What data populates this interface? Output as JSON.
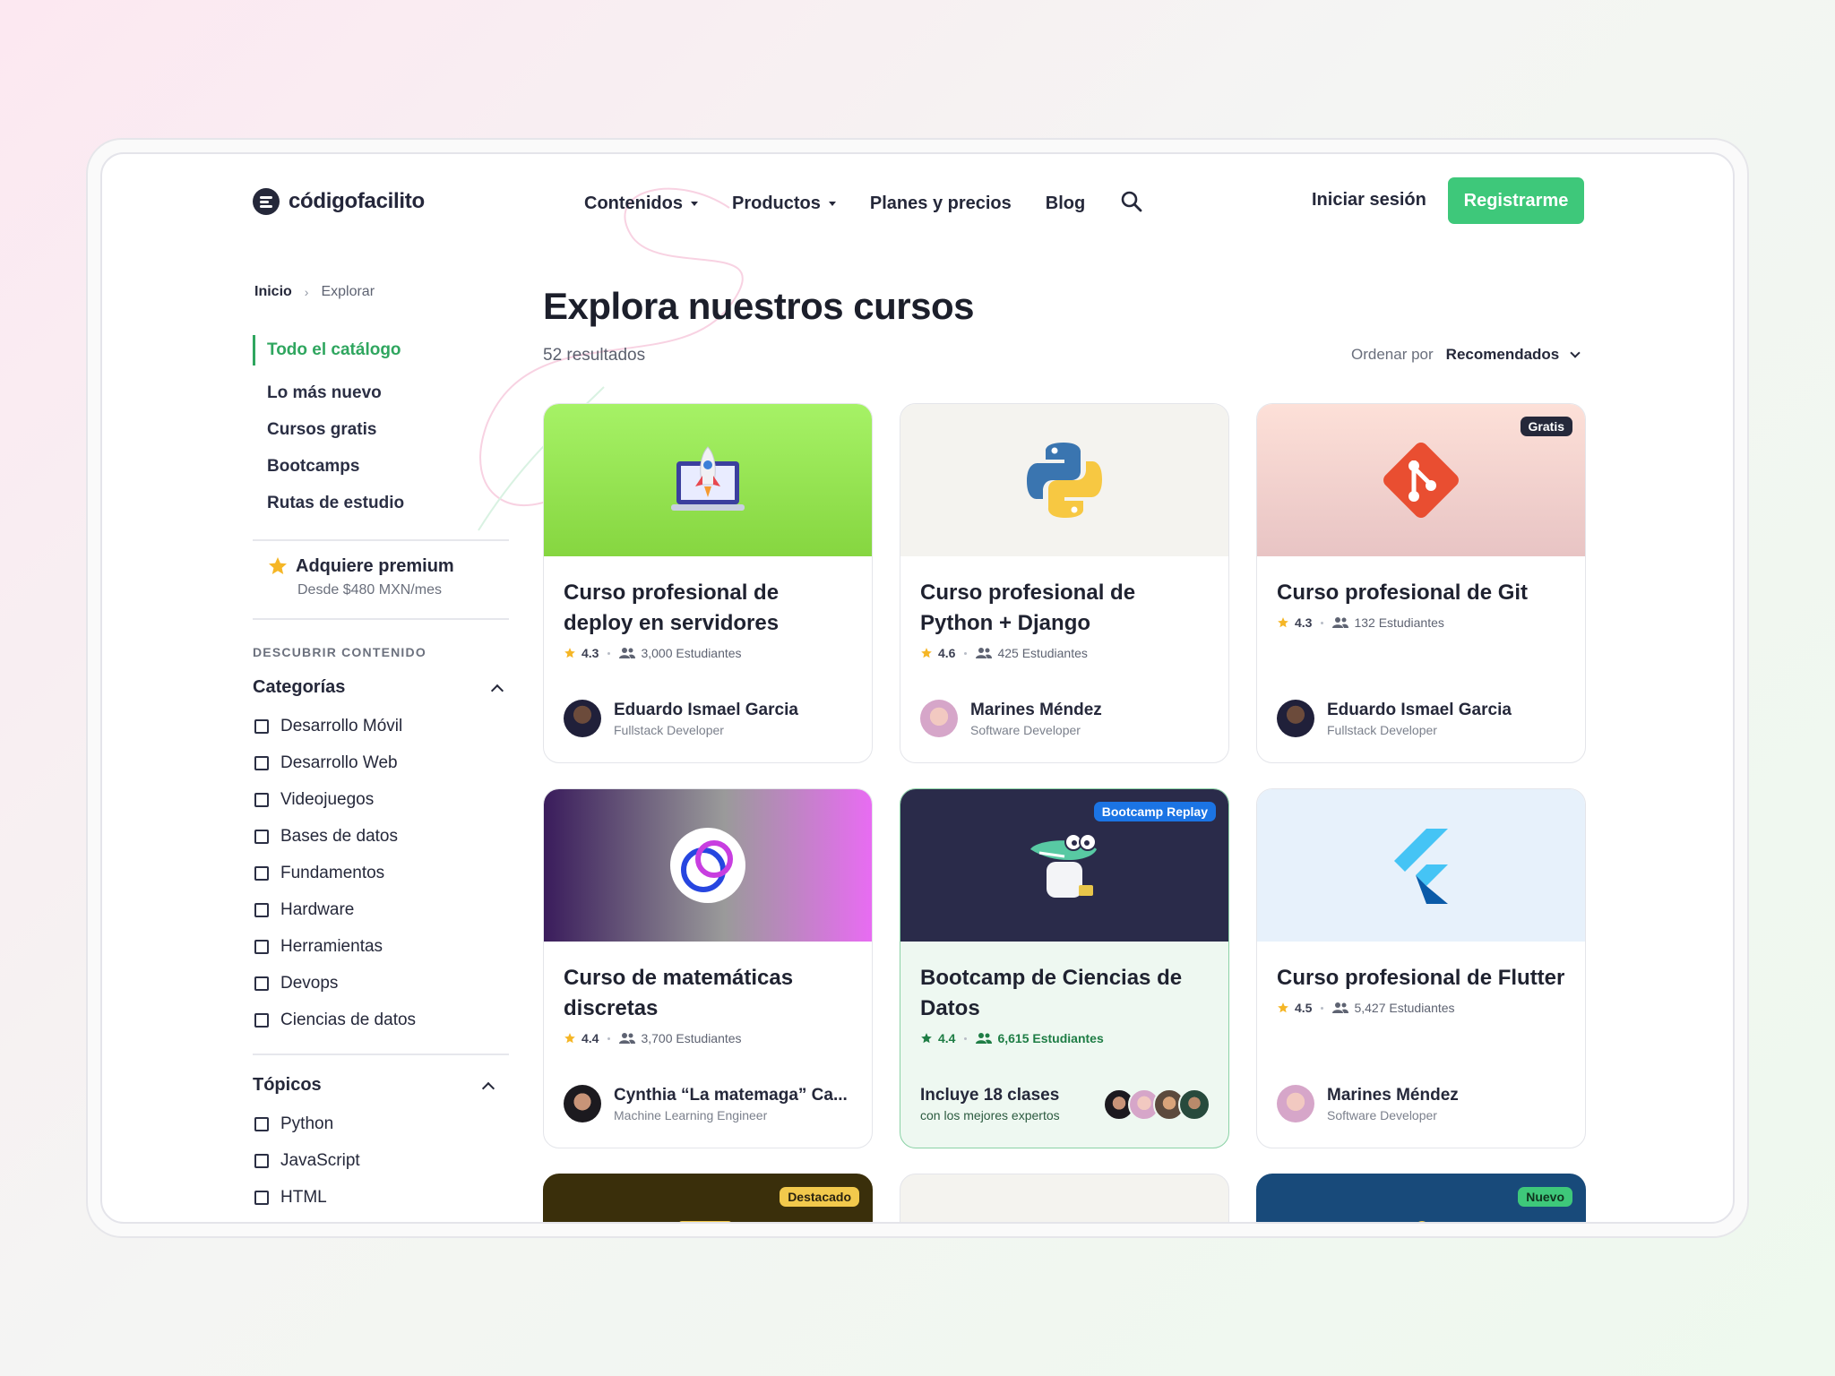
{
  "colors": {
    "brand_green": "#3ec87a",
    "active_green": "#2fa65f",
    "ink": "#25283a"
  },
  "header": {
    "logo_text": "códigofacilito",
    "nav": [
      {
        "label": "Contenidos",
        "has_caret": true
      },
      {
        "label": "Productos",
        "has_caret": true
      },
      {
        "label": "Planes y precios",
        "has_caret": false
      },
      {
        "label": "Blog",
        "has_caret": false
      }
    ],
    "search_icon": "search-icon",
    "login_label": "Iniciar sesión",
    "signup_label": "Registrarme"
  },
  "breadcrumb": {
    "home": "Inicio",
    "current": "Explorar"
  },
  "sidebar": {
    "links": [
      "Todo el catálogo",
      "Lo más nuevo",
      "Cursos gratis",
      "Bootcamps",
      "Rutas de estudio"
    ],
    "active_link": "Todo el catálogo",
    "premium": {
      "title": "Adquiere premium",
      "subtitle": "Desde $480 MXN/mes",
      "icon": "star-icon"
    },
    "discover_label": "DESCUBRIR CONTENIDO",
    "categories": {
      "title": "Categorías",
      "items": [
        "Desarrollo Móvil",
        "Desarrollo Web",
        "Videojuegos",
        "Bases de datos",
        "Fundamentos",
        "Hardware",
        "Herramientas",
        "Devops",
        "Ciencias de datos"
      ]
    },
    "topics": {
      "title": "Tópicos",
      "items": [
        "Python",
        "JavaScript",
        "HTML"
      ]
    }
  },
  "main": {
    "title": "Explora nuestros cursos",
    "results": "52 resultados",
    "sort_label": "Ordenar por",
    "sort_value": "Recomendados"
  },
  "cards": [
    {
      "title": "Curso profesional de deploy en servidores",
      "rating": "4.3",
      "students": "3,000 Estudiantes",
      "author": "Eduardo Ismael Garcia",
      "role": "Fullstack Developer"
    },
    {
      "title": "Curso profesional de Python + Django",
      "rating": "4.6",
      "students": "425 Estudiantes",
      "author": "Marines Méndez",
      "role": "Software Developer"
    },
    {
      "title": "Curso profesional de Git",
      "rating": "4.3",
      "students": "132 Estudiantes",
      "author": "Eduardo Ismael Garcia",
      "role": "Fullstack Developer",
      "badge": "Gratis"
    },
    {
      "title": "Curso de matemáticas discretas",
      "rating": "4.4",
      "students": "3,700 Estudiantes",
      "author": "Cynthia “La matemaga” Ca...",
      "role": "Machine Learning Engineer"
    },
    {
      "title": "Bootcamp de Ciencias de Datos",
      "rating": "4.4",
      "students": "6,615 Estudiantes",
      "includes": "Incluye 18 clases",
      "includes_sub": "con los mejores expertos",
      "badge": "Bootcamp Replay"
    },
    {
      "title": "Curso profesional de Flutter",
      "rating": "4.5",
      "students": "5,427 Estudiantes",
      "author": "Marines Méndez",
      "role": "Software Developer"
    }
  ],
  "partial_cards": [
    {
      "badge": "Destacado"
    },
    {
      "badge": ""
    },
    {
      "badge": "Nuevo"
    }
  ]
}
